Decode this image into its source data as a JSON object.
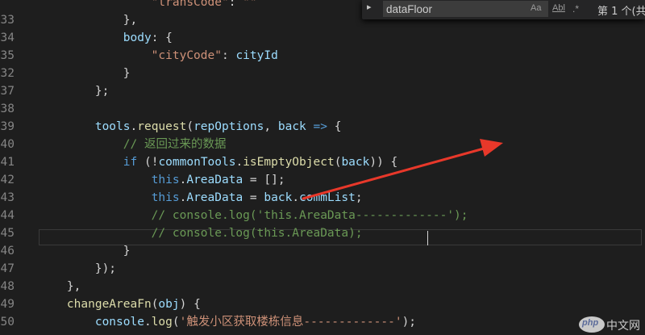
{
  "find_widget": {
    "toggle_glyph": "▸",
    "query": "dataFloor",
    "match_case_label": "Aa",
    "whole_word_label": "Abl",
    "regex_label": ".*",
    "result_label": "第 1 个(共"
  },
  "editor": {
    "lines": [
      {
        "num": "",
        "tokens": [
          {
            "t": "                \"transCode\"",
            "c": "s"
          },
          {
            "t": ": ",
            "c": "p"
          },
          {
            "t": "\"\"",
            "c": "s"
          }
        ]
      },
      {
        "num": "33",
        "tokens": [
          {
            "t": "            },",
            "c": "p"
          }
        ]
      },
      {
        "num": "34",
        "tokens": [
          {
            "t": "            body",
            "c": "v"
          },
          {
            "t": ": {",
            "c": "p"
          }
        ]
      },
      {
        "num": "35",
        "tokens": [
          {
            "t": "                \"cityCode\"",
            "c": "s"
          },
          {
            "t": ": ",
            "c": "p"
          },
          {
            "t": "cityId",
            "c": "v"
          }
        ]
      },
      {
        "num": "32",
        "tokens": [
          {
            "t": "            }",
            "c": "p"
          }
        ]
      },
      {
        "num": "37",
        "tokens": [
          {
            "t": "        };",
            "c": "p"
          }
        ]
      },
      {
        "num": "38",
        "tokens": []
      },
      {
        "num": "39",
        "tokens": [
          {
            "t": "        tools",
            "c": "v"
          },
          {
            "t": ".",
            "c": "p"
          },
          {
            "t": "request",
            "c": "f"
          },
          {
            "t": "(",
            "c": "p"
          },
          {
            "t": "repOptions",
            "c": "v"
          },
          {
            "t": ", ",
            "c": "p"
          },
          {
            "t": "back",
            "c": "v"
          },
          {
            "t": " => ",
            "c": "k"
          },
          {
            "t": "{",
            "c": "p"
          }
        ]
      },
      {
        "num": "40",
        "tokens": [
          {
            "t": "            // 返回过来的数据",
            "c": "c"
          }
        ]
      },
      {
        "num": "41",
        "tokens": [
          {
            "t": "            ",
            "c": "p"
          },
          {
            "t": "if",
            "c": "k"
          },
          {
            "t": " (!",
            "c": "p"
          },
          {
            "t": "commonTools",
            "c": "v"
          },
          {
            "t": ".",
            "c": "p"
          },
          {
            "t": "isEmptyObject",
            "c": "f"
          },
          {
            "t": "(",
            "c": "p"
          },
          {
            "t": "back",
            "c": "v"
          },
          {
            "t": ")) {",
            "c": "p"
          }
        ]
      },
      {
        "num": "42",
        "tokens": [
          {
            "t": "                ",
            "c": "p"
          },
          {
            "t": "this",
            "c": "k"
          },
          {
            "t": ".",
            "c": "p"
          },
          {
            "t": "AreaData",
            "c": "v"
          },
          {
            "t": " = [];",
            "c": "p"
          }
        ]
      },
      {
        "num": "43",
        "tokens": [
          {
            "t": "                ",
            "c": "p"
          },
          {
            "t": "this",
            "c": "k"
          },
          {
            "t": ".",
            "c": "p"
          },
          {
            "t": "AreaData",
            "c": "v"
          },
          {
            "t": " = ",
            "c": "p"
          },
          {
            "t": "back",
            "c": "v"
          },
          {
            "t": ".",
            "c": "p"
          },
          {
            "t": "commList",
            "c": "v"
          },
          {
            "t": ";",
            "c": "p"
          }
        ]
      },
      {
        "num": "44",
        "tokens": [
          {
            "t": "                // console.log('this.AreaData-------------');",
            "c": "c"
          }
        ]
      },
      {
        "num": "45",
        "tokens": [
          {
            "t": "                // console.log(this.AreaData);",
            "c": "c"
          }
        ]
      },
      {
        "num": "46",
        "tokens": [
          {
            "t": "            }",
            "c": "p"
          }
        ]
      },
      {
        "num": "47",
        "tokens": [
          {
            "t": "        });",
            "c": "p"
          }
        ]
      },
      {
        "num": "48",
        "tokens": [
          {
            "t": "    },",
            "c": "p"
          }
        ]
      },
      {
        "num": "49",
        "tokens": [
          {
            "t": "    changeAreaFn",
            "c": "f"
          },
          {
            "t": "(",
            "c": "p"
          },
          {
            "t": "obj",
            "c": "v"
          },
          {
            "t": ") {",
            "c": "p"
          }
        ]
      },
      {
        "num": "50",
        "tokens": [
          {
            "t": "        console",
            "c": "v"
          },
          {
            "t": ".",
            "c": "p"
          },
          {
            "t": "log",
            "c": "f"
          },
          {
            "t": "(",
            "c": "p"
          },
          {
            "t": "'触发小区获取楼栋信息-------------'",
            "c": "s"
          },
          {
            "t": ");",
            "c": "p"
          }
        ]
      }
    ]
  },
  "annotation": {
    "color": "#e8382a"
  },
  "watermark": {
    "logo_text": "php",
    "site_text": "中文网"
  }
}
